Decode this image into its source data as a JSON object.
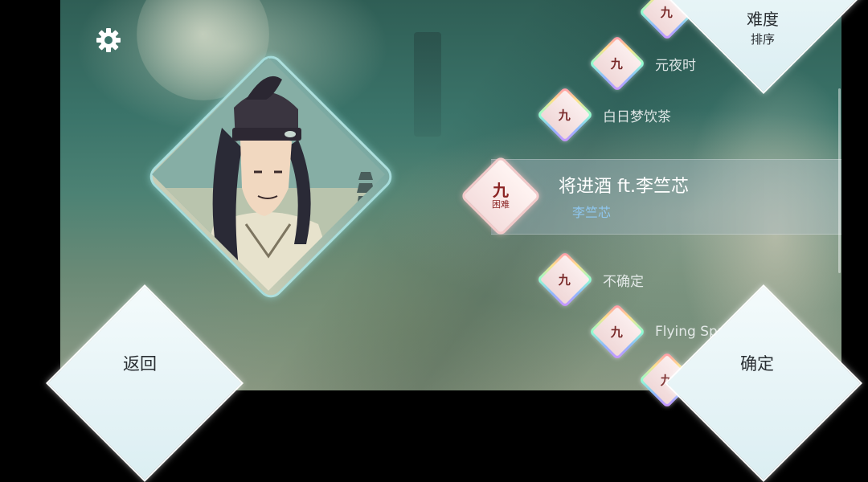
{
  "songs": [
    {
      "level": "九",
      "title": ""
    },
    {
      "level": "九",
      "title": "元夜时"
    },
    {
      "level": "九",
      "title": "白日梦饮茶"
    },
    {
      "level": "九",
      "title": "不确定"
    },
    {
      "level": "九",
      "title": "Flying Spri"
    },
    {
      "level": "九",
      "title": ""
    }
  ],
  "selected_song": {
    "level": "九",
    "difficulty": "困难",
    "title": "将进酒 ft.李竺芯",
    "artist": "李竺芯"
  },
  "sort": {
    "title": "难度",
    "subtitle": "排序"
  },
  "buttons": {
    "back": "返回",
    "confirm": "确定"
  },
  "icons": {
    "settings": "gear-icon"
  },
  "colors": {
    "accent_artist": "#8fc7ef",
    "level_text": "#8b2323",
    "panel": "#f4fbfc"
  }
}
